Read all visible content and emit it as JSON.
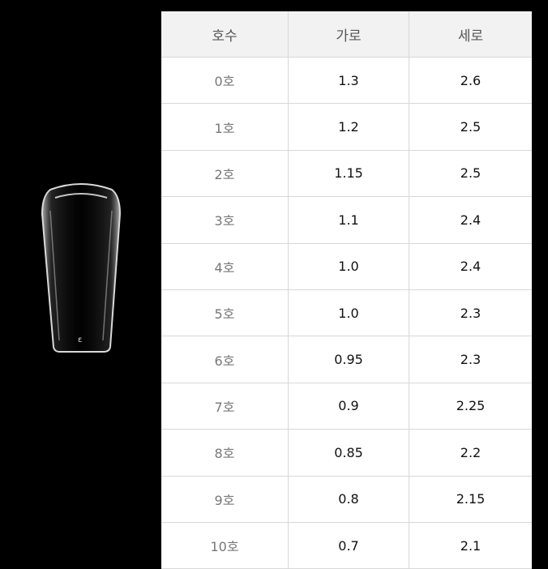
{
  "table": {
    "headers": [
      "호수",
      "가로",
      "세로"
    ],
    "rows": [
      {
        "size": "0호",
        "width": "1.3",
        "length": "2.6"
      },
      {
        "size": "1호",
        "width": "1.2",
        "length": "2.5"
      },
      {
        "size": "2호",
        "width": "1.15",
        "length": "2.5"
      },
      {
        "size": "3호",
        "width": "1.1",
        "length": "2.4"
      },
      {
        "size": "4호",
        "width": "1.0",
        "length": "2.4"
      },
      {
        "size": "5호",
        "width": "1.0",
        "length": "2.3"
      },
      {
        "size": "6호",
        "width": "0.95",
        "length": "2.3"
      },
      {
        "size": "7호",
        "width": "0.9",
        "length": "2.25"
      },
      {
        "size": "8호",
        "width": "0.85",
        "length": "2.2"
      },
      {
        "size": "9호",
        "width": "0.8",
        "length": "2.15"
      },
      {
        "size": "10호",
        "width": "0.7",
        "length": "2.1"
      }
    ]
  },
  "image": {
    "name": "clear-nail-tip",
    "background": "#000000"
  }
}
